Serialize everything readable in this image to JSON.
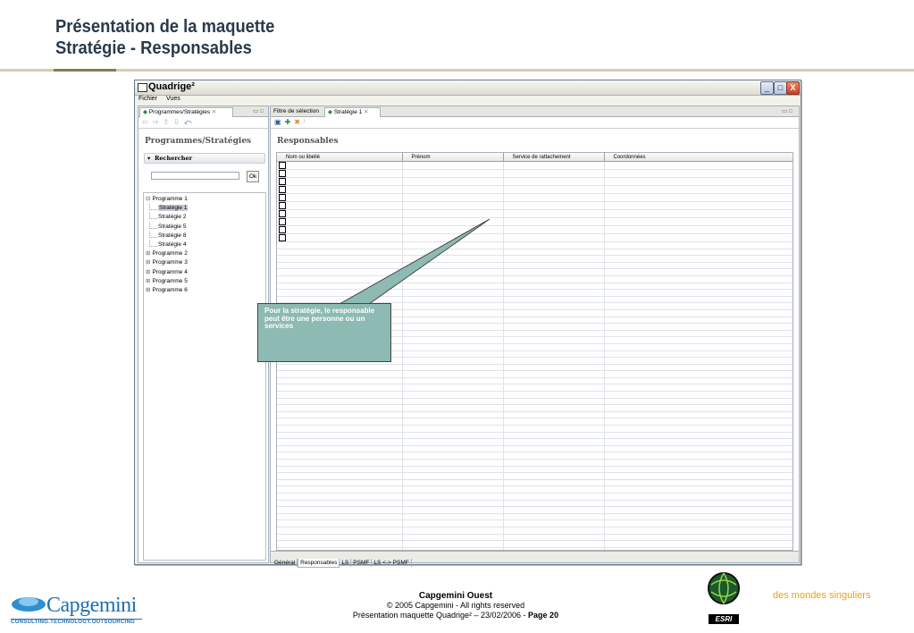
{
  "slide": {
    "title_line1": "Présentation de la maquette",
    "title_line2": "Stratégie - Responsables"
  },
  "window": {
    "title": "Quadrige²",
    "minimize": "_",
    "maximize": "□",
    "close": "X"
  },
  "menu": {
    "items": [
      "Fichier",
      "Vues"
    ]
  },
  "left_pane": {
    "tab_label": "Programmes/Stratégies",
    "tab_close": "✕",
    "heading": "Programmes/Stratégies",
    "search_section": "Rechercher",
    "search_value": "",
    "ok_label": "Ok",
    "tree": [
      {
        "label": "Programme 1",
        "expander": "⊟",
        "children": [
          "Stratégie 1",
          "Stratégie 2",
          "Stratégie 5",
          "Stratégie 8",
          "Stratégie 4"
        ]
      },
      {
        "label": "Programme 2",
        "expander": "⊞"
      },
      {
        "label": "Programme 3",
        "expander": "⊞"
      },
      {
        "label": "Programme 4",
        "expander": "⊞"
      },
      {
        "label": "Programme 5",
        "expander": "⊞"
      },
      {
        "label": "Programme 6",
        "expander": "⊞"
      }
    ],
    "selected_item": "Stratégie 1"
  },
  "right_pane": {
    "tabs": [
      "Filtre de sélection",
      "Stratégie 1"
    ],
    "tab_close": "✕",
    "heading": "Responsables",
    "columns": [
      "Nom ou libellé",
      "Prénom",
      "Service de rattachement",
      "Coordonnées"
    ],
    "checkbox_rows": 10,
    "bottom_tabs": [
      "Général",
      "Responsables",
      "LS",
      "PSMF",
      "LS <-> PSMF"
    ],
    "active_bottom_tab": "Responsables"
  },
  "callout": {
    "text": "Pour la stratégie, le responsable peut être une personne ou un services"
  },
  "footer": {
    "company": "Capgemini Ouest",
    "copyright": "© 2005 Capgemini - All rights reserved",
    "presentation_prefix": "Présentation maquette Quadrige² – 23/02/2006 - ",
    "page_label": "Page 20",
    "logo_name": "Capgemini",
    "logo_sub": "CONSULTING.TECHNOLOGY.OUTSOURCING",
    "esri_label": "ESRI",
    "tagline": "des mondes singuliers"
  },
  "colors": {
    "callout_bg": "#8dbab2",
    "brand_blue": "#1f6fae",
    "tagline_orange": "#e8a020"
  }
}
